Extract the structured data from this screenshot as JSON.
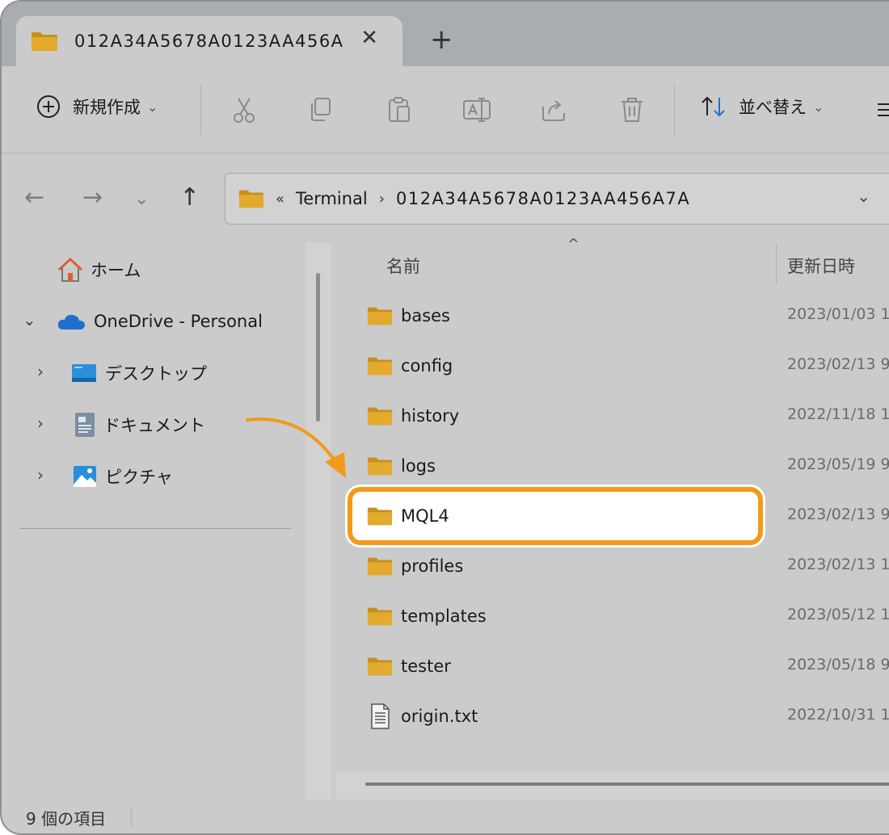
{
  "tab": {
    "title": "012A34A5678A0123AA456A",
    "close": "✕",
    "new_tab": "+"
  },
  "toolbar": {
    "new_label": "新規作成",
    "sort_label": "並べ替え",
    "chevron": "⌄"
  },
  "nav": {
    "back": "←",
    "forward": "→",
    "recent": "⌄",
    "up": "↑"
  },
  "address": {
    "more": "«",
    "crumb1": "Terminal",
    "separator": "›",
    "crumb2": "012A34A5678A0123AA456A7A",
    "dropdown": "⌄"
  },
  "sidebar": {
    "home": "ホーム",
    "onedrive": "OneDrive - Personal",
    "desktop": "デスクトップ",
    "documents": "ドキュメント",
    "pictures": "ピクチャ",
    "expand": "›",
    "collapse": "⌄"
  },
  "columns": {
    "name": "名前",
    "date": "更新日時",
    "sort_indicator": "^"
  },
  "files": [
    {
      "name": "bases",
      "date": "2023/01/03 1",
      "type": "folder"
    },
    {
      "name": "config",
      "date": "2023/02/13 9",
      "type": "folder"
    },
    {
      "name": "history",
      "date": "2022/11/18 1",
      "type": "folder"
    },
    {
      "name": "logs",
      "date": "2023/05/19 9",
      "type": "folder"
    },
    {
      "name": "MQL4",
      "date": "2023/02/13 9",
      "type": "folder",
      "highlighted": true
    },
    {
      "name": "profiles",
      "date": "2023/02/13 1",
      "type": "folder"
    },
    {
      "name": "templates",
      "date": "2023/05/12 1",
      "type": "folder"
    },
    {
      "name": "tester",
      "date": "2023/05/18 9",
      "type": "folder"
    },
    {
      "name": "origin.txt",
      "date": "2022/10/31 1",
      "type": "file"
    }
  ],
  "status": {
    "count": "9 個の項目"
  },
  "colors": {
    "highlight_border": "#f29a1a",
    "folder": "#e3aa2e",
    "onedrive": "#1f6fd1"
  }
}
